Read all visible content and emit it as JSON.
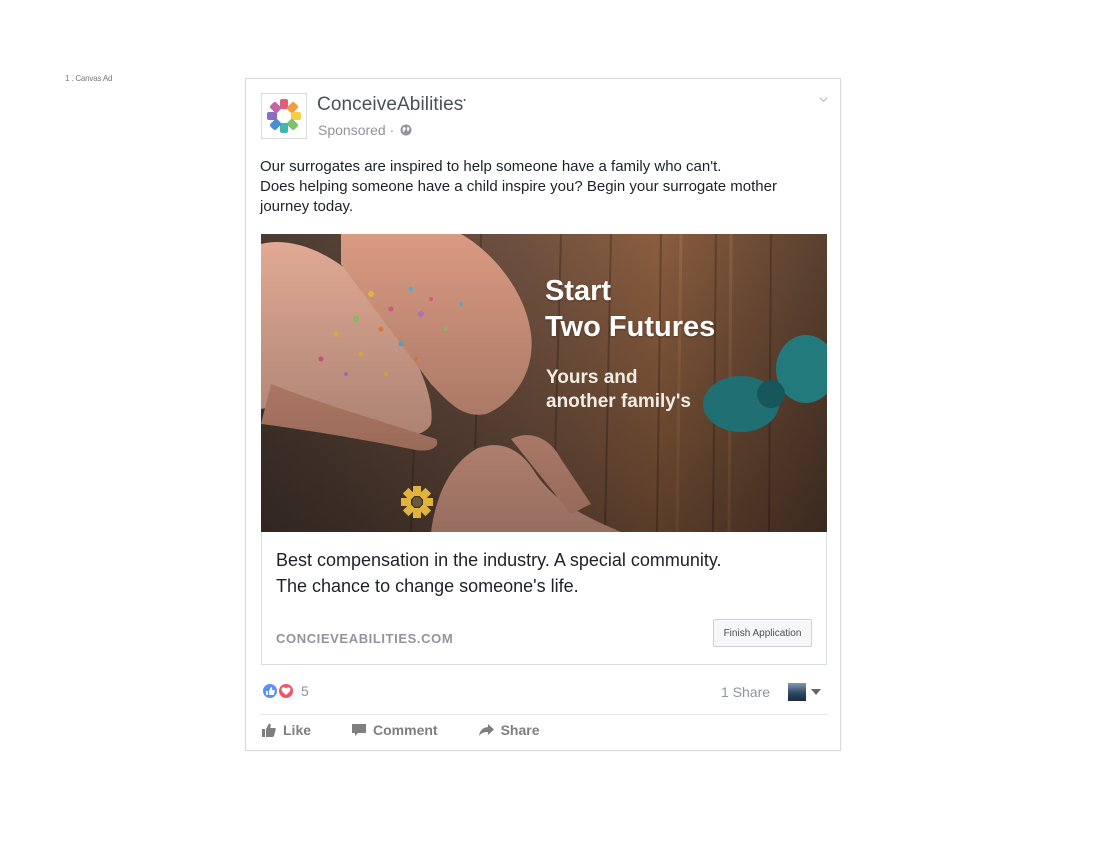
{
  "page_label": "1 . Canvas Ad",
  "post": {
    "page_name": "ConceiveAbilities",
    "page_name_mark": "•",
    "sponsored": "Sponsored ·",
    "text_lines": [
      "Our surrogates are inspired to help someone have a family who can't.",
      "Does helping someone have a child inspire you? Begin your surrogate mother",
      "journey today."
    ]
  },
  "media": {
    "headline_lines": [
      "Start",
      "Two Futures"
    ],
    "subheadline_lines": [
      "Yours and",
      "another family's"
    ]
  },
  "link": {
    "description_lines": [
      "Best compensation in the industry. A special community.",
      "The chance to change someone's life."
    ],
    "domain": "CONCIEVEABILITIES.COM",
    "cta_label": "Finish Application"
  },
  "engagement": {
    "reaction_count": "5",
    "share_count": "1 Share"
  },
  "actions": {
    "like": "Like",
    "comment": "Comment",
    "share": "Share"
  },
  "colors": {
    "like_blue": "#5890ff",
    "love_red": "#f25268",
    "meta_gray": "#90949c"
  }
}
